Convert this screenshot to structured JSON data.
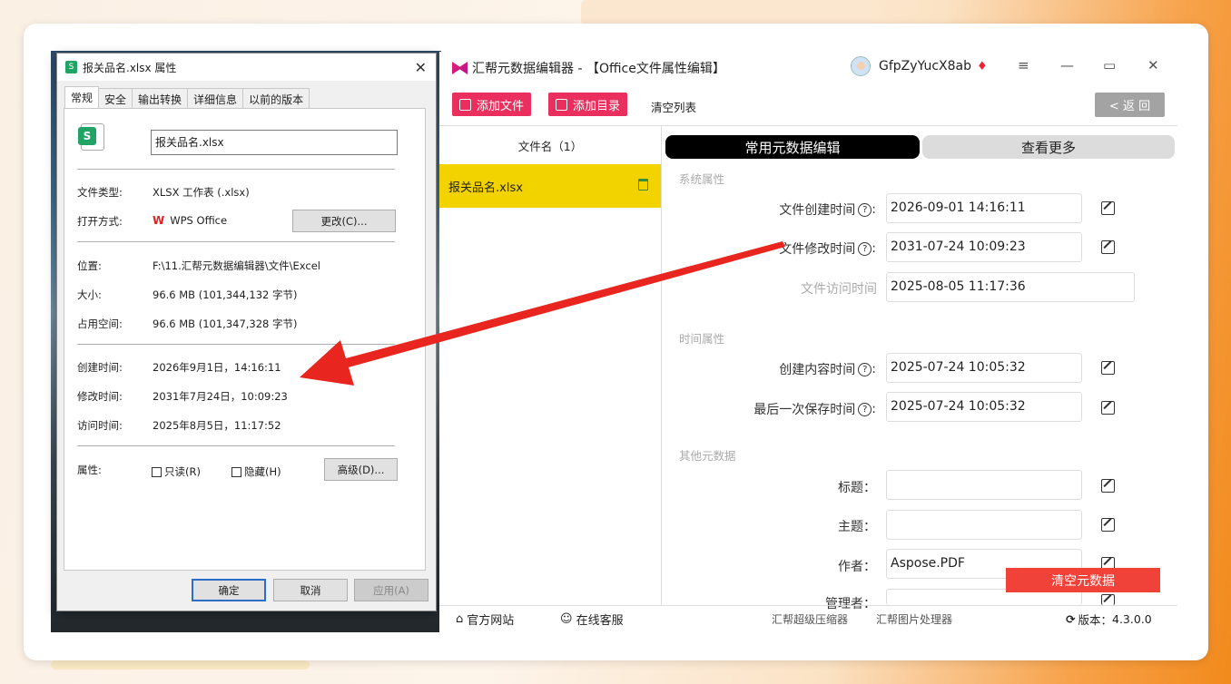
{
  "dialog": {
    "title": "报关品名.xlsx 属性",
    "tabs": [
      "常规",
      "安全",
      "输出转换",
      "详细信息",
      "以前的版本"
    ],
    "file_name": "报关品名.xlsx",
    "type_label": "文件类型:",
    "type_value": "XLSX 工作表 (.xlsx)",
    "open_label": "打开方式:",
    "open_value": "WPS Office",
    "change_button": "更改(C)...",
    "location_label": "位置:",
    "location_value": "F:\\11.汇帮元数据编辑器\\文件\\Excel",
    "size_label": "大小:",
    "size_value": "96.6 MB (101,344,132 字节)",
    "disk_label": "占用空间:",
    "disk_value": "96.6 MB (101,347,328 字节)",
    "created_label": "创建时间:",
    "created_value": "2026年9月1日，14:16:11",
    "modified_label": "修改时间:",
    "modified_value": "2031年7月24日，10:09:23",
    "accessed_label": "访问时间:",
    "accessed_value": "2025年8月5日，11:17:52",
    "attr_label": "属性:",
    "readonly": "只读(R)",
    "hidden": "隐藏(H)",
    "advanced_button": "高级(D)...",
    "ok": "确定",
    "cancel": "取消",
    "apply": "应用(A)"
  },
  "app": {
    "title": "汇帮元数据编辑器 - 【Office文件属性编辑】",
    "username": "GfpZyYucX8ab",
    "add_file": "添加文件",
    "add_dir": "添加目录",
    "clear_list": "清空列表",
    "back": "< 返 回",
    "list_header": "文件名（1）",
    "file_item": "报关品名.xlsx",
    "tab_common": "常用元数据编辑",
    "tab_more": "查看更多",
    "section_system": "系统属性",
    "created_label": "文件创建时间",
    "created_value": "2026-09-01 14:16:11",
    "modified_label": "文件修改时间",
    "modified_value": "2031-07-24 10:09:23",
    "accessed_label": "文件访问时间",
    "accessed_value": "2025-08-05 11:17:36",
    "section_time": "时间属性",
    "content_created_label": "创建内容时间",
    "content_created_value": "2025-07-24 10:05:32",
    "last_saved_label": "最后一次保存时间",
    "last_saved_value": "2025-07-24 10:05:32",
    "section_other": "其他元数据",
    "title_label": "标题：",
    "subject_label": "主题：",
    "author_label": "作者：",
    "author_value": "Aspose.PDF",
    "manager_label": "管理者：",
    "clear_meta": "清空元数据",
    "footer_site": "官方网站",
    "footer_service": "在线客服",
    "footer_compress": "汇帮超级压缩器",
    "footer_image": "汇帮图片处理器",
    "version_label": "版本：",
    "version_value": "4.3.0.0"
  },
  "colors": {
    "accent": "#ea2f5f",
    "highlight": "#f2d300",
    "danger": "#f1423a",
    "arrow": "#e8261f"
  }
}
